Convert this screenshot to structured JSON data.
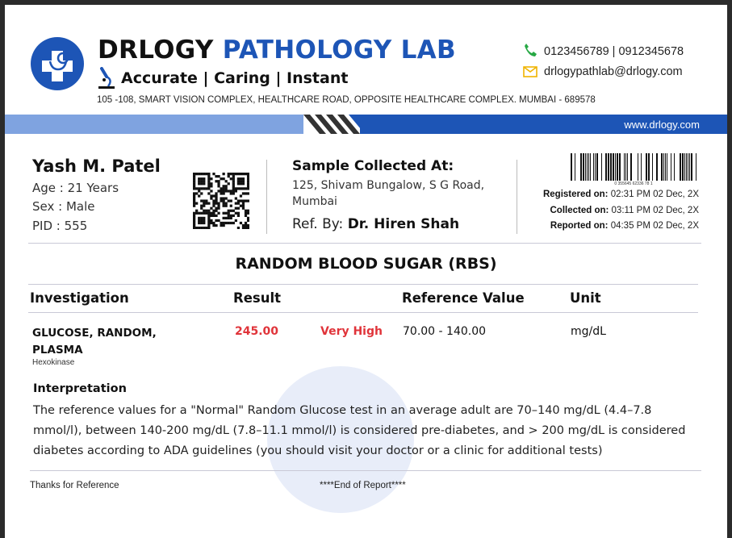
{
  "header": {
    "brand_part1": "DRLOGY",
    "brand_part2": "PATHOLOGY LAB",
    "tagline": "Accurate  | Caring  |  Instant",
    "address": "105 -108, SMART VISION COMPLEX, HEALTHCARE ROAD, OPPOSITE HEALTHCARE COMPLEX. MUMBAI - 689578",
    "phone": "0123456789  | 0912345678",
    "email": "drlogypathlab@drlogy.com",
    "website": "www.drlogy.com",
    "icons": [
      "stethoscope-cross-logo-icon",
      "microscope-icon",
      "phone-icon",
      "envelope-icon",
      "qr-code-icon",
      "barcode-icon"
    ],
    "colors": {
      "brand_blue": "#1d55b6",
      "band_light_blue": "#7fa3e0",
      "alert_red": "#e0343a"
    }
  },
  "patient": {
    "name": "Yash M. Patel",
    "age": "Age : 21 Years",
    "sex": "Sex : Male",
    "pid": "PID : 555"
  },
  "sample": {
    "title": "Sample Collected At:",
    "address": "125, Shivam Bungalow, S G Road, Mumbai",
    "ref_label": "Ref. By:",
    "ref_doctor": "Dr. Hiren Shah"
  },
  "barcode_number": "0 355645 62336 78 1",
  "dates": {
    "registered_label": "Registered on:",
    "registered": "02:31 PM 02 Dec, 2X",
    "collected_label": "Collected on:",
    "collected": "03:11 PM 02 Dec, 2X",
    "reported_label": "Reported on:",
    "reported": "04:35 PM 02 Dec, 2X"
  },
  "report": {
    "title": "RANDOM BLOOD SUGAR (RBS)",
    "columns": [
      "Investigation",
      "Result",
      "Reference Value",
      "Unit"
    ],
    "row": {
      "investigation": "GLUCOSE, RANDOM, PLASMA",
      "method": "Hexokinase",
      "result": "245.00",
      "flag": "Very High",
      "reference": "70.00 - 140.00",
      "unit": "mg/dL"
    },
    "interpretation_title": "Interpretation",
    "interpretation_text": "The reference values for a \"Normal\" Random Glucose test in an average adult are 70–140 mg/dL (4.4–7.8 mmol/l), between 140-200 mg/dL (7.8–11.1 mmol/l) is considered pre-diabetes, and > 200 mg/dL is considered diabetes according to ADA guidelines (you should visit your doctor or a clinic for additional tests)"
  },
  "footer": {
    "left": "Thanks for Reference",
    "center": "****End of Report****"
  }
}
